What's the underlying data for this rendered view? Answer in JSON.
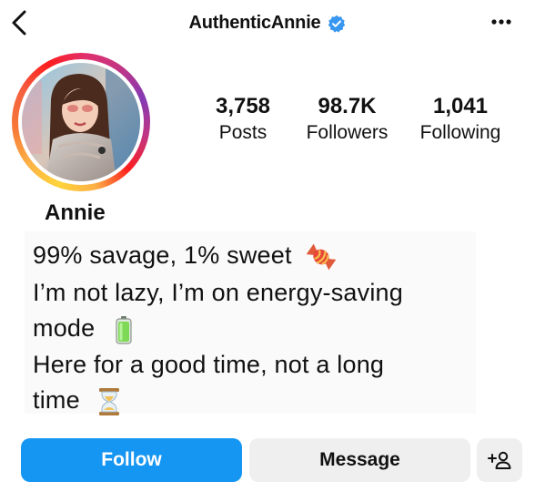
{
  "header": {
    "username": "AuthenticAnnie",
    "back_icon": "chevron-left-icon",
    "verified_icon": "verified-badge-icon",
    "more_icon": "more-horizontal-icon"
  },
  "profile": {
    "avatar": "profile-photo",
    "display_name": "Annie",
    "stats": [
      {
        "value": "3,758",
        "label": "Posts"
      },
      {
        "value": "98.7K",
        "label": "Followers"
      },
      {
        "value": "1,041",
        "label": "Following"
      }
    ]
  },
  "bio": {
    "lines": [
      "99% savage, 1% sweet",
      "I’m not lazy, I’m on energy-saving",
      "mode",
      "Here for a good time, not a long",
      "time"
    ],
    "emojis": [
      "candy-icon",
      "battery-icon",
      "hourglass-icon"
    ]
  },
  "actions": {
    "follow_label": "Follow",
    "message_label": "Message",
    "suggest_icon": "add-person-icon"
  },
  "colors": {
    "follow_blue": "#1596f2",
    "secondary_button": "#efefef",
    "verified_blue": "#3897f0"
  }
}
